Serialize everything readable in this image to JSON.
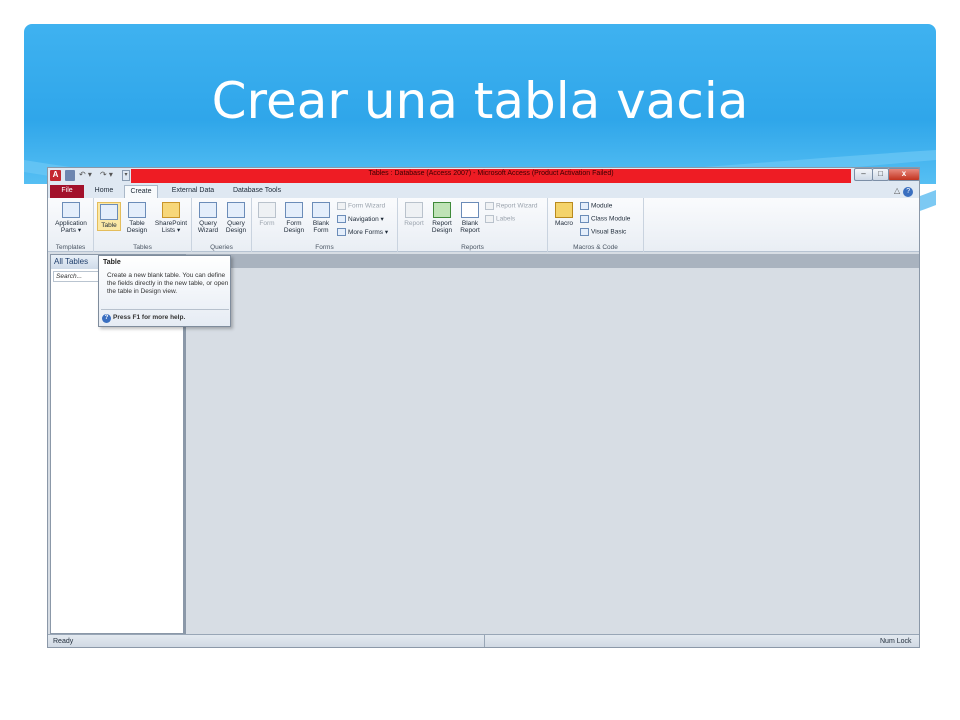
{
  "slide": {
    "title": "Crear una tabla vacia"
  },
  "window": {
    "title": "Tables : Database (Access 2007) - Microsoft Access (Product Activation Failed)",
    "quick_access": {
      "app_letter": "A",
      "undo": "↶ ▾",
      "redo": "↷ ▾",
      "customize": "▾"
    },
    "controls": {
      "minimize": "–",
      "maximize": "□",
      "close": "x"
    }
  },
  "tabs": [
    {
      "label": "File"
    },
    {
      "label": "Home"
    },
    {
      "label": "Create"
    },
    {
      "label": "External Data"
    },
    {
      "label": "Database Tools"
    }
  ],
  "tab_icons": {
    "collapse": "△",
    "help": "?"
  },
  "ribbon": {
    "templates": {
      "label": "Templates",
      "app_parts_1": "Application",
      "app_parts_2": "Parts ▾"
    },
    "tables": {
      "label": "Tables",
      "table": "Table",
      "table_design_1": "Table",
      "table_design_2": "Design",
      "sharepoint_1": "SharePoint",
      "sharepoint_2": "Lists ▾"
    },
    "queries": {
      "label": "Queries",
      "wizard_1": "Query",
      "wizard_2": "Wizard",
      "design_1": "Query",
      "design_2": "Design"
    },
    "forms": {
      "label": "Forms",
      "form": "Form",
      "form_design_1": "Form",
      "form_design_2": "Design",
      "blank_form_1": "Blank",
      "blank_form_2": "Form",
      "form_wizard": "Form Wizard",
      "navigation": "Navigation ▾",
      "more_forms": "More Forms ▾"
    },
    "reports": {
      "label": "Reports",
      "report": "Report",
      "report_design_1": "Report",
      "report_design_2": "Design",
      "blank_report_1": "Blank",
      "blank_report_2": "Report",
      "report_wizard": "Report Wizard",
      "labels": "Labels"
    },
    "macros": {
      "label": "Macros & Code",
      "macro": "Macro",
      "module": "Module",
      "class_module": "Class Module",
      "visual_basic": "Visual Basic"
    }
  },
  "nav_pane": {
    "header": "All Tables",
    "search_placeholder": "Search..."
  },
  "tooltip": {
    "title": "Table",
    "body": "Create a new blank table. You can define the fields directly in the new table, or open the table in Design view.",
    "help": "Press F1 for more help."
  },
  "status_bar": {
    "ready": "Ready",
    "num_lock": "Num Lock"
  }
}
